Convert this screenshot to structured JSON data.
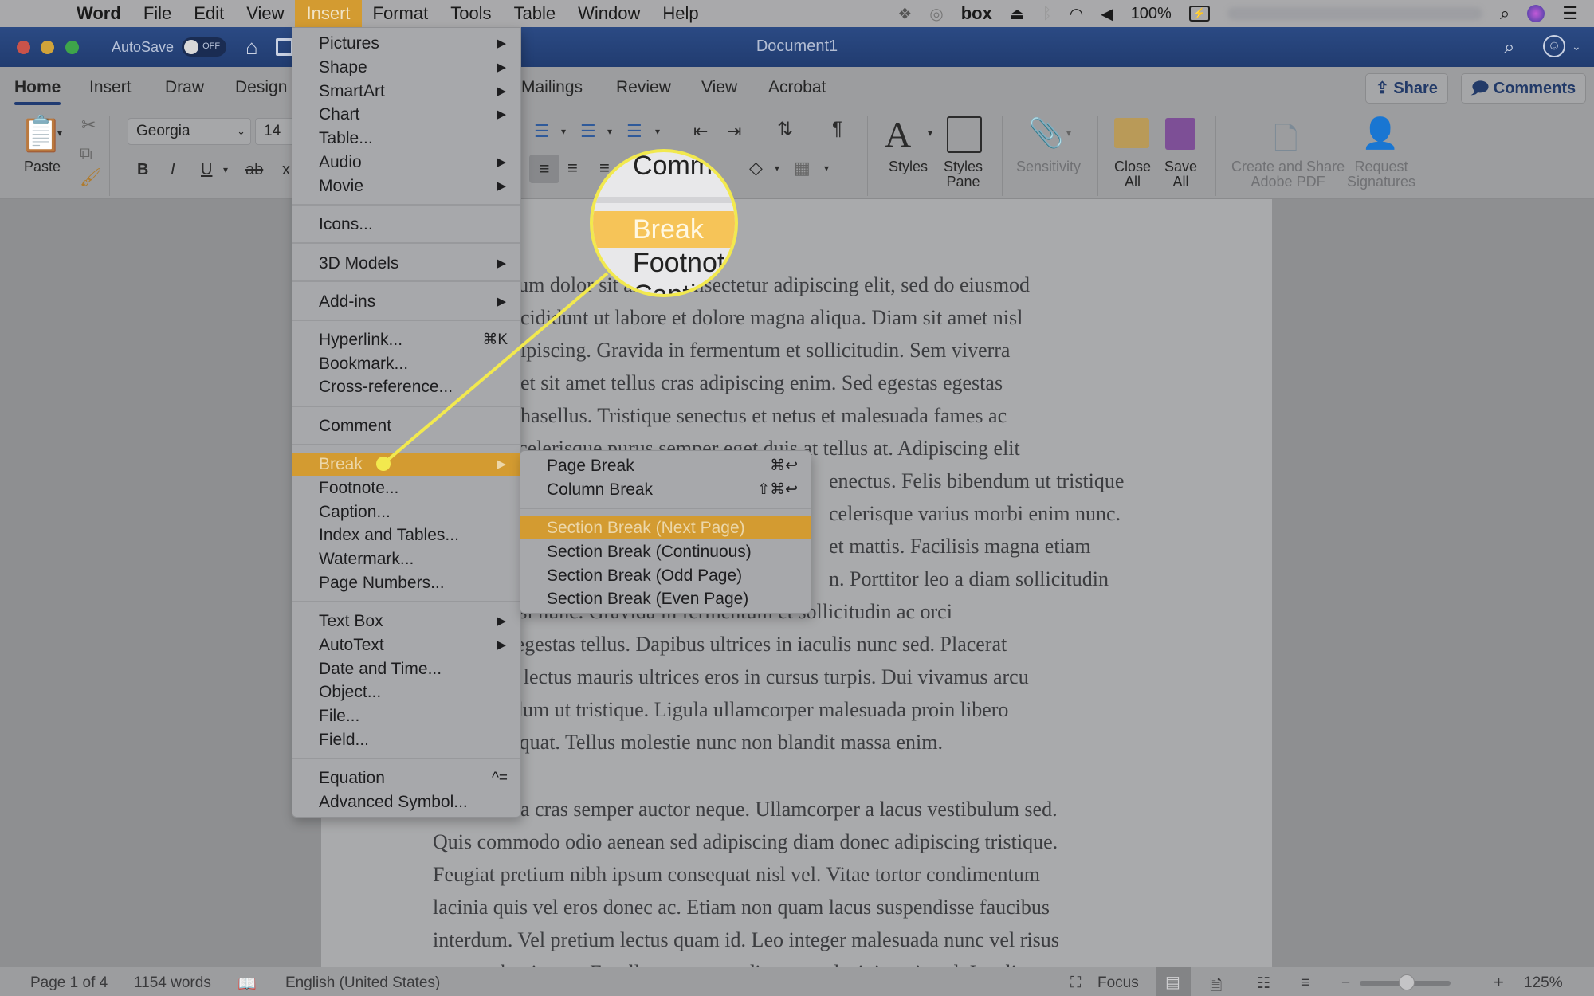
{
  "menubar": {
    "app_name": "Word",
    "items": [
      "File",
      "Edit",
      "View",
      "Insert",
      "Format",
      "Tools",
      "Table",
      "Window",
      "Help"
    ],
    "active_item": "Insert",
    "status": {
      "battery": "100%",
      "icons": [
        "dropbox-icon",
        "creative-cloud-icon",
        "box-icon",
        "airplay-icon",
        "bluetooth-icon",
        "wifi-icon",
        "volume-icon",
        "battery-icon",
        "spotlight-search-icon",
        "siri-icon",
        "notification-center-icon"
      ],
      "box_label": "box"
    }
  },
  "titlebar": {
    "autosave_label": "AutoSave",
    "autosave_state": "OFF",
    "document_title": "Document1"
  },
  "ribbon": {
    "tabs": [
      "Home",
      "Insert",
      "Draw",
      "Design",
      "Mailings",
      "Review",
      "View",
      "Acrobat"
    ],
    "active_tab": "Home",
    "paste_label": "Paste",
    "font_name": "Georgia",
    "font_size": "14",
    "format_buttons": [
      "B",
      "I",
      "U",
      "ab",
      "x"
    ],
    "styles_label": "Styles",
    "styles_pane_label": "Styles\nPane",
    "sensitivity_label": "Sensitivity",
    "close_all_label": "Close\nAll",
    "save_all_label": "Save\nAll",
    "create_share_pdf_label": "Create and Share\nAdobe PDF",
    "request_signatures_label": "Request\nSignatures",
    "share_label": "Share",
    "comments_label": "Comments"
  },
  "insert_menu": {
    "groups": [
      [
        {
          "label": "Pictures",
          "submenu": true
        },
        {
          "label": "Shape",
          "submenu": true
        },
        {
          "label": "SmartArt",
          "submenu": true
        },
        {
          "label": "Chart",
          "submenu": true
        },
        {
          "label": "Table...",
          "submenu": false
        },
        {
          "label": "Audio",
          "submenu": true
        },
        {
          "label": "Movie",
          "submenu": true
        }
      ],
      [
        {
          "label": "Icons...",
          "submenu": false
        }
      ],
      [
        {
          "label": "3D Models",
          "submenu": true
        }
      ],
      [
        {
          "label": "Add-ins",
          "submenu": true
        }
      ],
      [
        {
          "label": "Hyperlink...",
          "shortcut": "⌘K"
        },
        {
          "label": "Bookmark..."
        },
        {
          "label": "Cross-reference..."
        }
      ],
      [
        {
          "label": "Comment"
        }
      ],
      [
        {
          "label": "Break",
          "submenu": true,
          "highlighted": true
        },
        {
          "label": "Footnote..."
        },
        {
          "label": "Caption..."
        },
        {
          "label": "Index and Tables..."
        },
        {
          "label": "Watermark..."
        },
        {
          "label": "Page Numbers..."
        }
      ],
      [
        {
          "label": "Text Box",
          "submenu": true
        },
        {
          "label": "AutoText",
          "submenu": true
        },
        {
          "label": "Date and Time..."
        },
        {
          "label": "Object..."
        },
        {
          "label": "File..."
        },
        {
          "label": "Field..."
        }
      ],
      [
        {
          "label": "Equation",
          "shortcut": "^="
        },
        {
          "label": "Advanced Symbol..."
        }
      ]
    ]
  },
  "break_menu": {
    "groups": [
      [
        {
          "label": "Page Break",
          "shortcut": "⌘↩"
        },
        {
          "label": "Column Break",
          "shortcut": "⇧⌘↩"
        }
      ],
      [
        {
          "label": "Section Break (Next Page)",
          "highlighted": true
        },
        {
          "label": "Section Break (Continuous)"
        },
        {
          "label": "Section Break (Odd Page)"
        },
        {
          "label": "Section Break (Even Page)"
        }
      ]
    ]
  },
  "magnifier": {
    "rows": [
      "Comm",
      "Break",
      "Footnot",
      "Capti"
    ],
    "highlight_color": "#f6c458",
    "ring_color": "#f2e94e"
  },
  "document": {
    "paragraph1": [
      "Lorem ipsum dolor sit amet, consectetur adipiscing elit, sed do eiusmod",
      "tempor incididunt ut labore et dolore magna aliqua. Diam sit amet nisl",
      "suscipit adipiscing. Gravida in fermentum et sollicitudin. Sem viverra",
      "aliquet eget sit amet tellus cras adipiscing enim. Sed egestas egestas",
      "fringilla phasellus. Tristique senectus et netus et malesuada fames ac",
      "turpis egestas. Scelerisque purus semper eget duis at tellus at. Adipiscing elit",
      "pellentesque habitant morbi tristique senectus. Felis bibendum ut tristique",
      "et egestas quis ipsum. Scelerisque varius morbi enim nunc.",
      "Pellentesque elit eget gravida cum sociis et mattis. Facilisis magna etiam",
      "tempor orci eu lobortis elementum nibh tellus molestie nunc non blandit massa enim. Porttitor leo a diam sollicitudin",
      "tempor id eu nisl nunc. Gravida in fermentum et sollicitudin ac orci",
      "phasellus egestas tellus. Dapibus ultrices in iaculis nunc sed. Placerat",
      "vestibulum lectus mauris ultrices eros in cursus turpis. Dui vivamus arcu",
      "felis bibendum ut tristique. Ligula ullamcorper malesuada proin libero",
      "nunc consequat. Tellus molestie nunc non blandit massa enim."
    ],
    "paragraph1_visible": [
      "sum dolor sit amet, consectetur adipiscing elit, sed do eiusmod",
      "ncididunt ut labore et dolore magna aliqua. Diam sit amet nisl",
      "dipiscing. Gravida in fermentum et sollicitudin. Sem viverra",
      "get sit amet tellus cras adipiscing enim. Sed egestas egestas",
      "phasellus. Tristique senectus et netus et malesuada fames ac",
      "scelerisque purus semper eget duis at tellus at. Adipiscing elit",
      "enectus. Felis bibendum ut tristique",
      "celerisque varius morbi enim nunc.",
      "et mattis. Facilisis magna etiam",
      "n. Porttitor leo a diam sollicitudin",
      "eu nisl nunc. Gravida in fermentum et sollicitudin ac orci",
      "s egestas tellus. Dapibus ultrices in iaculis nunc sed. Placerat",
      "m lectus mauris ultrices eros in cursus turpis. Dui vivamus arcu",
      "ndum ut tristique. Ligula ullamcorper malesuada proin libero",
      "sequat. Tellus molestie nunc non blandit massa enim."
    ],
    "paragraph2_visible": [
      "a cras semper auctor neque. Ullamcorper a lacus vestibulum sed.",
      "Quis commodo odio aenean sed adipiscing diam donec adipiscing tristique.",
      "Feugiat pretium nibh ipsum consequat nisl vel. Vitae tortor condimentum",
      "lacinia quis vel eros donec ac. Etiam non quam lacus suspendisse faucibus",
      "interdum. Vel pretium lectus quam id. Leo integer malesuada nunc vel risus",
      "commodo viverra. Et tellus tortor condimentum lacinia quis vel. Iaculis"
    ]
  },
  "statusbar": {
    "page": "Page 1 of 4",
    "words": "1154 words",
    "language": "English (United States)",
    "focus_label": "Focus",
    "zoom_level": "125%",
    "zoom_slider_fraction": 0.52
  },
  "colors": {
    "menu_highlight": "#d39b31",
    "titlebar": "#213c70",
    "callout": "#f2e94e"
  }
}
